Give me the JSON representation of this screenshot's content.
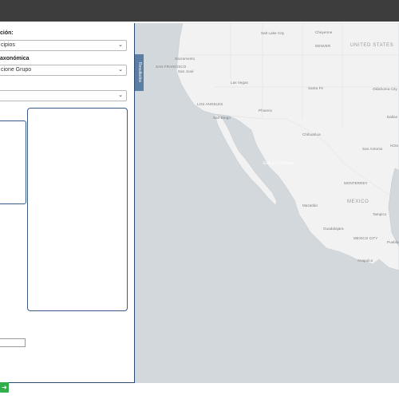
{
  "left_panel": {
    "label1": "ción:",
    "select1": "cipios",
    "label2": "axonómica",
    "select2": "cione Grupo",
    "select3": ""
  },
  "map": {
    "tab_label": "Resultados",
    "labels": {
      "salt_lake": "Salt Lake City",
      "cheyenne": "Cheyenne",
      "denver": "DENVER",
      "united_states": "UNITED STATES",
      "sacramento": "Sacramento",
      "san_francisco": "SAN FRANCISCO",
      "san_jose": "San José",
      "las_vegas": "Las Vegas",
      "santa_fe": "Santa Fe",
      "oklahoma": "Oklahoma City",
      "los_angeles": "LOS ANGELES",
      "phoenix": "Phoenix",
      "dallas": "Dallas",
      "san_diego": "San Diego",
      "chihuahua": "Chihuahua",
      "san_antonio": "San Antonio",
      "houston": "HOU",
      "gulf": "Gulf of California",
      "monterrey": "MONTERREY",
      "mexico": "MEXICO",
      "mazatlan": "Mazatlán",
      "tampico": "Tampico",
      "guadalajara": "Guadalajara",
      "mexico_city": "MEXICO CITY",
      "puebla": "Puebla",
      "acapulco": "Acapulco"
    }
  },
  "colors": {
    "topbar": "#3d3d3d",
    "land": "#f2f2f2",
    "water": "#d3d8dc",
    "accent": "#3a5b86",
    "green_button": "#2fae4a"
  },
  "icons": {
    "chevron": "chevron-down-icon",
    "arrow": "arrow-right-icon"
  }
}
